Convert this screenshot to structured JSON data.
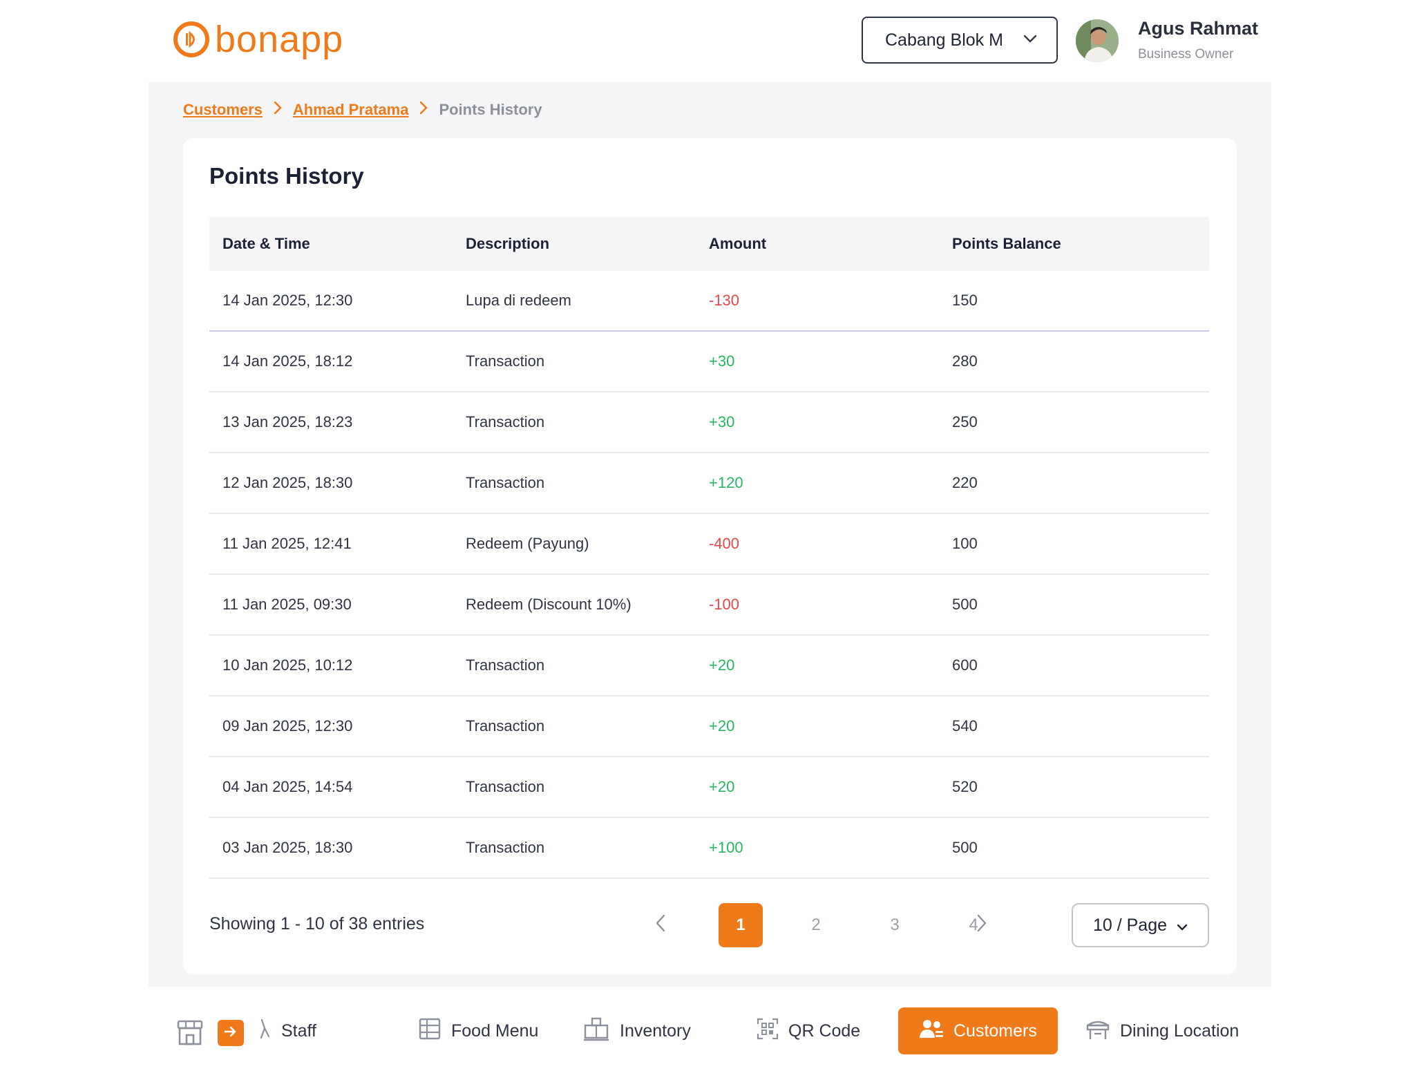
{
  "header": {
    "logo_text": "bonapp",
    "branch": "Cabang Blok M",
    "user_name": "Agus Rahmat",
    "user_role": "Business Owner"
  },
  "breadcrumb": {
    "items": [
      "Customers",
      "Ahmad Pratama"
    ],
    "current": "Points History"
  },
  "card": {
    "title": "Points History"
  },
  "table": {
    "columns": [
      "Date & Time",
      "Description",
      "Amount",
      "Points Balance"
    ],
    "rows": [
      {
        "datetime": "14 Jan 2025, 12:30",
        "description": "Lupa di redeem",
        "amount": "-130",
        "balance": "150"
      },
      {
        "datetime": "14 Jan 2025, 18:12",
        "description": "Transaction",
        "amount": "+30",
        "balance": "280"
      },
      {
        "datetime": "13 Jan 2025, 18:23",
        "description": "Transaction",
        "amount": "+30",
        "balance": "250"
      },
      {
        "datetime": "12 Jan 2025, 18:30",
        "description": "Transaction",
        "amount": "+120",
        "balance": "220"
      },
      {
        "datetime": "11 Jan 2025, 12:41",
        "description": "Redeem (Payung)",
        "amount": "-400",
        "balance": "100"
      },
      {
        "datetime": "11 Jan 2025, 09:30",
        "description": "Redeem (Discount 10%)",
        "amount": "-100",
        "balance": "500"
      },
      {
        "datetime": "10 Jan 2025, 10:12",
        "description": "Transaction",
        "amount": "+20",
        "balance": "600"
      },
      {
        "datetime": "09 Jan 2025, 12:30",
        "description": "Transaction",
        "amount": "+20",
        "balance": "540"
      },
      {
        "datetime": "04 Jan 2025, 14:54",
        "description": "Transaction",
        "amount": "+20",
        "balance": "520"
      },
      {
        "datetime": "03 Jan 2025, 18:30",
        "description": "Transaction",
        "amount": "+100",
        "balance": "500"
      }
    ]
  },
  "pagination": {
    "showing": "Showing 1 - 10 of 38 entries",
    "pages": [
      "1",
      "2",
      "3",
      "4"
    ],
    "active_page": "1",
    "page_size": "10 / Page"
  },
  "nav": {
    "items": [
      "Staff",
      "Food Menu",
      "Inventory",
      "QR Code",
      "Customers",
      "Dining Location"
    ],
    "active": "Customers"
  },
  "colors": {
    "accent": "#ef7a1a",
    "negative": "#e8474a",
    "positive": "#28b463"
  }
}
